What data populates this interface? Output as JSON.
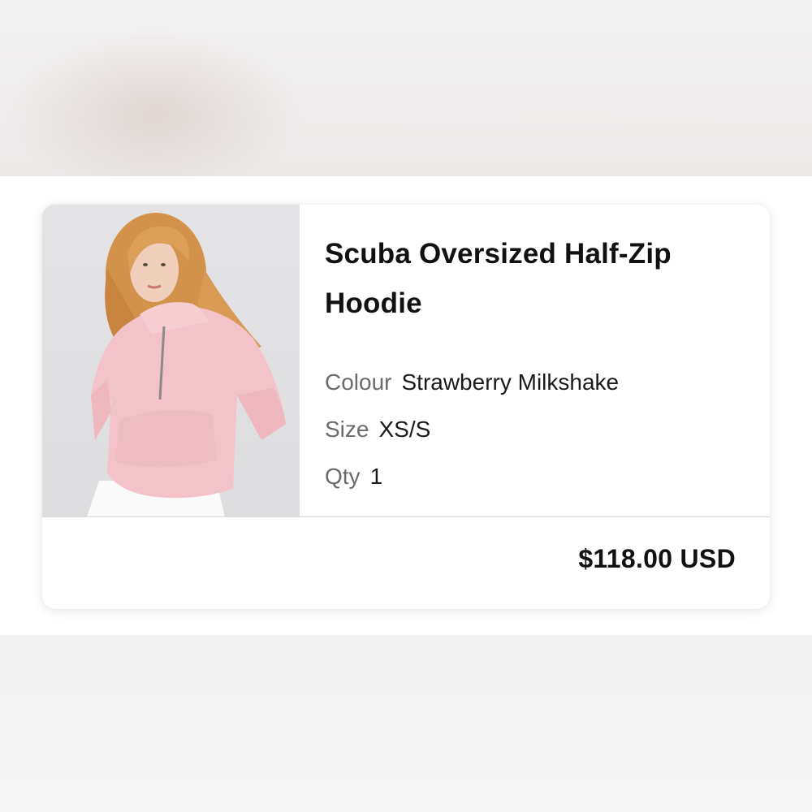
{
  "product": {
    "title": "Scuba Oversized Half-Zip Hoodie",
    "image_alt": "Model wearing pink half-zip hoodie",
    "attributes": [
      {
        "label": "Colour",
        "value": "Strawberry Milkshake"
      },
      {
        "label": "Size",
        "value": "XS/S"
      },
      {
        "label": "Qty",
        "value": "1"
      }
    ],
    "price": "$118.00 USD"
  },
  "colors": {
    "hoodie_pink": "#f4c3c9",
    "hair": "#d89a55",
    "text_primary": "#111111",
    "text_label": "#6b6b6b"
  }
}
